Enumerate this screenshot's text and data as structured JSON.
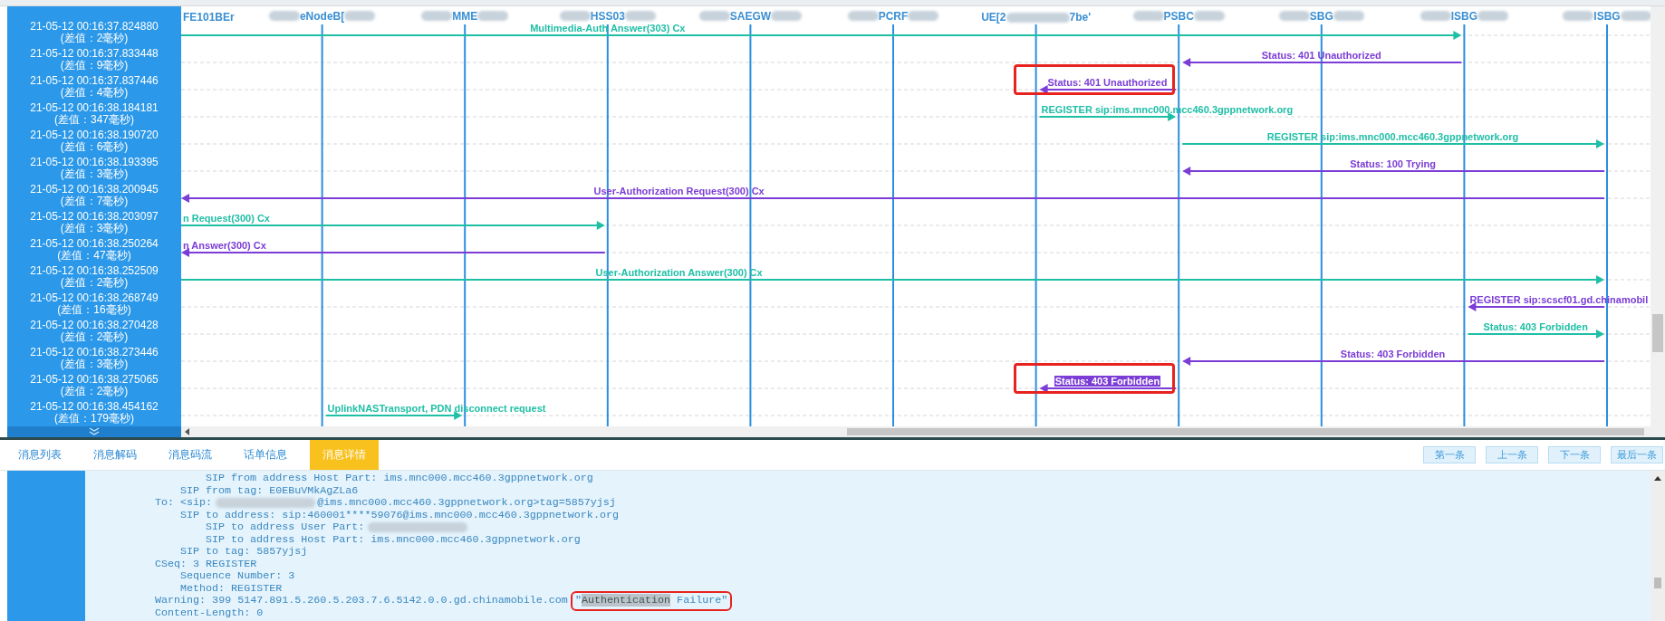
{
  "lifelines": [
    {
      "parts": [
        "FE101BEr"
      ],
      "redacted": false
    },
    {
      "parts": [
        "eNodeB["
      ],
      "redacted": true
    },
    {
      "parts": [
        "MME"
      ],
      "redacted": true
    },
    {
      "parts": [
        "HSS03"
      ],
      "redacted": true
    },
    {
      "parts": [
        "SAEGW"
      ],
      "redacted": true
    },
    {
      "parts": [
        "PCRF"
      ],
      "redacted": true
    },
    {
      "parts": [
        "UE[2",
        "7be'"
      ],
      "redacted": true
    },
    {
      "parts": [
        "PSBC"
      ],
      "redacted": true
    },
    {
      "parts": [
        "SBG"
      ],
      "redacted": true
    },
    {
      "parts": [
        "ISBG"
      ],
      "redacted": true
    },
    {
      "parts": [
        "ISBG"
      ],
      "redacted": true
    }
  ],
  "sidebar": {
    "rows": [
      {
        "time": "21-05-12 00:16:37.824880",
        "delta": "(差值：2毫秒)"
      },
      {
        "time": "21-05-12 00:16:37.833448",
        "delta": "(差值：9毫秒)"
      },
      {
        "time": "21-05-12 00:16:37.837446",
        "delta": "(差值：4毫秒)"
      },
      {
        "time": "21-05-12 00:16:38.184181",
        "delta": "(差值：347毫秒)"
      },
      {
        "time": "21-05-12 00:16:38.190720",
        "delta": "(差值：6毫秒)"
      },
      {
        "time": "21-05-12 00:16:38.193395",
        "delta": "(差值：3毫秒)"
      },
      {
        "time": "21-05-12 00:16:38.200945",
        "delta": "(差值：7毫秒)"
      },
      {
        "time": "21-05-12 00:16:38.203097",
        "delta": "(差值：3毫秒)"
      },
      {
        "time": "21-05-12 00:16:38.250264",
        "delta": "(差值：47毫秒)"
      },
      {
        "time": "21-05-12 00:16:38.252509",
        "delta": "(差值：2毫秒)"
      },
      {
        "time": "21-05-12 00:16:38.268749",
        "delta": "(差值：16毫秒)"
      },
      {
        "time": "21-05-12 00:16:38.270428",
        "delta": "(差值：2毫秒)"
      },
      {
        "time": "21-05-12 00:16:38.273446",
        "delta": "(差值：3毫秒)"
      },
      {
        "time": "21-05-12 00:16:38.275065",
        "delta": "(差值：2毫秒)"
      },
      {
        "time": "21-05-12 00:16:38.454162",
        "delta": "(差值：179毫秒)"
      }
    ]
  },
  "messages": [
    {
      "label": "Multimedia-Auth Answer(303) Cx",
      "color": "#1fbfa6",
      "leftward": false,
      "highlighted": false,
      "selected": false
    },
    {
      "label": "Status: 401 Unauthorized",
      "color": "#7b3dd6",
      "leftward": true,
      "highlighted": false,
      "selected": false
    },
    {
      "label": "Status: 401 Unauthorized",
      "color": "#7b3dd6",
      "leftward": true,
      "highlighted": true,
      "selected": false
    },
    {
      "label": "REGISTER sip:ims.mnc000.mcc460.3gppnetwork.org",
      "color": "#1fbfa6",
      "leftward": false,
      "highlighted": false,
      "selected": false
    },
    {
      "label": "REGISTER sip:ims.mnc000.mcc460.3gppnetwork.org",
      "color": "#1fbfa6",
      "leftward": false,
      "highlighted": false,
      "selected": false
    },
    {
      "label": "Status: 100 Trying",
      "color": "#7b3dd6",
      "leftward": true,
      "highlighted": false,
      "selected": false
    },
    {
      "label": "User-Authorization Request(300) Cx",
      "color": "#7b3dd6",
      "leftward": true,
      "highlighted": false,
      "selected": false
    },
    {
      "label": "n Request(300) Cx",
      "color": "#1fbfa6",
      "leftward": false,
      "highlighted": false,
      "selected": false
    },
    {
      "label": "n Answer(300) Cx",
      "color": "#7b3dd6",
      "leftward": true,
      "highlighted": false,
      "selected": false
    },
    {
      "label": "User-Authorization Answer(300) Cx",
      "color": "#1fbfa6",
      "leftward": false,
      "highlighted": false,
      "selected": false
    },
    {
      "label": "REGISTER sip:scscf01.gd.chinamobil",
      "color": "#7b3dd6",
      "leftward": true,
      "highlighted": false,
      "selected": false
    },
    {
      "label": "Status: 403 Forbidden",
      "color": "#1fbfa6",
      "leftward": false,
      "highlighted": false,
      "selected": false
    },
    {
      "label": "Status: 403 Forbidden",
      "color": "#7b3dd6",
      "leftward": true,
      "highlighted": false,
      "selected": false
    },
    {
      "label": "Status: 403 Forbidden",
      "color": "#7b3dd6",
      "leftward": true,
      "highlighted": true,
      "selected": true
    },
    {
      "label": "UplinkNASTransport, PDN disconnect request",
      "color": "#1fbfa6",
      "leftward": false,
      "highlighted": false,
      "selected": false
    }
  ],
  "tabs": [
    {
      "label": "消息列表",
      "selected": false
    },
    {
      "label": "消息解码",
      "selected": false
    },
    {
      "label": "消息码流",
      "selected": false
    },
    {
      "label": "话单信息",
      "selected": false
    },
    {
      "label": "消息详情",
      "selected": true
    }
  ],
  "buttons": [
    "第一条",
    "上一条",
    "下一条",
    "最后一条"
  ],
  "detail": {
    "lines": [
      {
        "children": [
          {
            "children": [
              {
                "text": "SIP from address Host Part: ims.mnc000.mcc460.3gppnetwork.org"
              }
            ]
          },
          {
            "text": "SIP from tag: E0EBuVMkAgZLa6"
          }
        ]
      },
      {
        "text": "To: <sip:",
        "redacted": true,
        "text_after": "@ims.mnc000.mcc460.3gppnetwork.org>tag=5857yjsj",
        "children": [
          {
            "text": "SIP to address: sip:460001****59076@ims.mnc000.mcc460.3gppnetwork.org",
            "children": [
              {
                "text": "SIP to address User Part:",
                "redacted": true
              },
              {
                "text": "SIP to address Host Part: ims.mnc000.mcc460.3gppnetwork.org"
              }
            ]
          },
          {
            "text": "SIP to tag: 5857yjsj"
          }
        ]
      },
      {
        "text": "CSeq: 3 REGISTER",
        "children": [
          {
            "text": "Sequence Number: 3"
          },
          {
            "text": "Method: REGISTER"
          }
        ]
      },
      {
        "text": "Warning: 399 5147.891.5.260.5.203.7.6.5142.0.0.gd.chinamobile.com",
        "note": {
          "before": "\"",
          "highlighted": "Authentication",
          "after": " Failure\"",
          "boxed": true
        }
      },
      {
        "text": "Content-Length: 0"
      }
    ]
  }
}
